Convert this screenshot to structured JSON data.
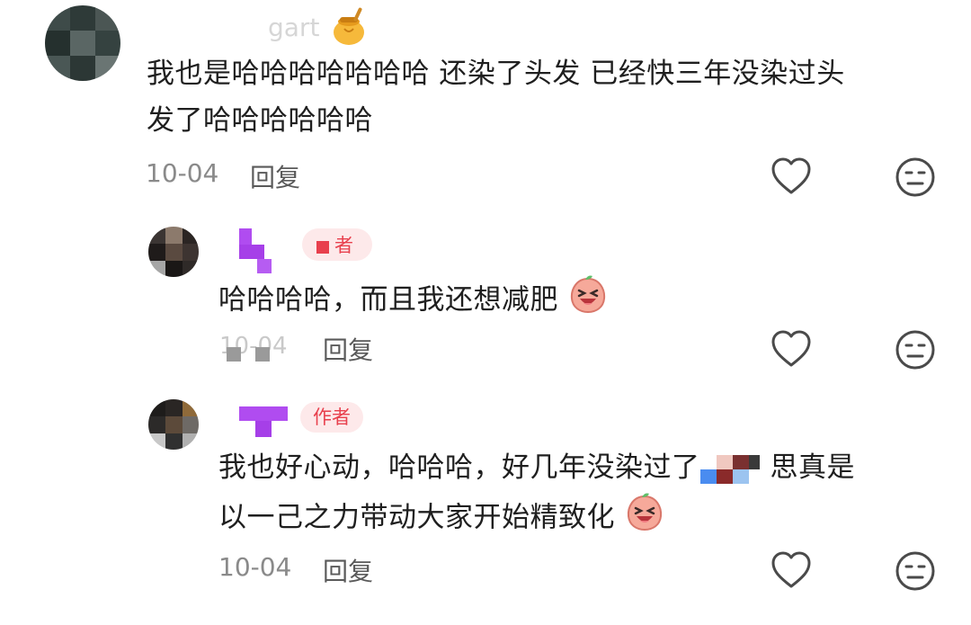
{
  "comments": [
    {
      "username": "gart",
      "text_line1": "我也是哈哈哈哈哈哈哈 还染了头发 已经快三年没染过头",
      "text_line2": "发了哈哈哈哈哈哈",
      "date": "10-04",
      "reply_label": "回复"
    },
    {
      "badge": "者",
      "text": "哈哈哈哈，而且我还想减肥",
      "date": "10-04",
      "reply_label": "回复"
    },
    {
      "badge": "作者",
      "text_line1_a": "我也好心动，哈哈哈，好几年没染过了",
      "text_line1_b": "思真是",
      "text_line2": "以一己之力带动大家开始精致化",
      "date": "10-04",
      "reply_label": "回复"
    }
  ],
  "icons": {
    "like": "heart-outline-icon",
    "dislike": "meh-face-icon",
    "username_emoji": "honey-pot-icon",
    "inline_emoji": "laughing-peach-icon"
  },
  "colors": {
    "badge_bg": "#fde9ea",
    "badge_text": "#e8404d",
    "meta": "#8a8a8a",
    "text": "#1f1f1f"
  }
}
